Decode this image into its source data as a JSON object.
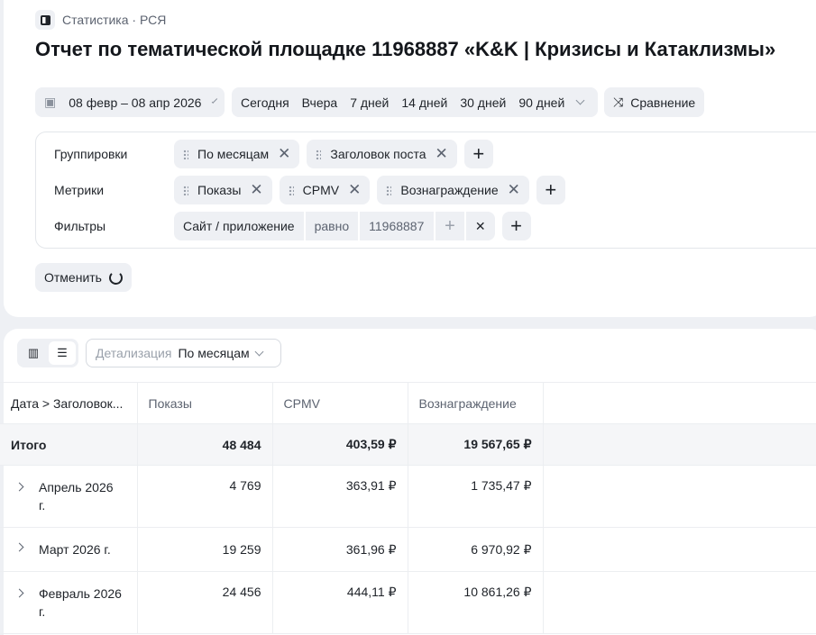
{
  "breadcrumb": "Статистика · РСЯ",
  "title": "Отчет по тематической площадке 11968887 «K&K | Кризисы и Катаклизмы»",
  "date_range": "08 февр – 08 апр 2026",
  "periods": [
    "Сегодня",
    "Вчера",
    "7 дней",
    "14 дней",
    "30 дней",
    "90 дней"
  ],
  "compare": "Сравнение",
  "groupings": {
    "label": "Группировки",
    "items": [
      "По месяцам",
      "Заголовок поста"
    ]
  },
  "metrics": {
    "label": "Метрики",
    "items": [
      "Показы",
      "CPMV",
      "Вознаграждение"
    ]
  },
  "filters": {
    "label": "Фильтры",
    "field": "Сайт / приложение",
    "op": "равно",
    "value": "11968887"
  },
  "cancel": "Отменить",
  "detail": {
    "label": "Детализация",
    "value": "По месяцам"
  },
  "table": {
    "headers": [
      "Дата > Заголовок...",
      "Показы",
      "CPMV",
      "Вознаграждение"
    ],
    "total": [
      "Итого",
      "48 484",
      "403,59 ₽",
      "19 567,65 ₽"
    ],
    "rows": [
      [
        "Апрель 2026 г.",
        "4 769",
        "363,91 ₽",
        "1 735,47 ₽"
      ],
      [
        "Март 2026 г.",
        "19 259",
        "361,96 ₽",
        "6 970,92 ₽"
      ],
      [
        "Февраль 2026 г.",
        "24 456",
        "444,11 ₽",
        "10 861,26 ₽"
      ]
    ]
  }
}
